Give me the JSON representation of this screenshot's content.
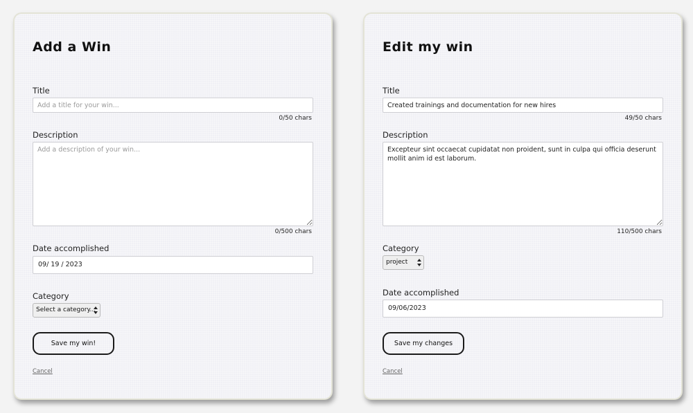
{
  "add_form": {
    "title": "Add a Win",
    "title_label": "Title",
    "title_placeholder": "Add a title for your win...",
    "title_value": "",
    "title_counter": "0/50 chars",
    "description_label": "Description",
    "description_placeholder": "Add a description of your win...",
    "description_value": "",
    "description_counter": "0/500 chars",
    "date_label": "Date accomplished",
    "date_value": "09/ 19 / 2023",
    "category_label": "Category",
    "category_selected": "Select a category...",
    "save_label": "Save my win!",
    "cancel_label": "Cancel"
  },
  "edit_form": {
    "title": "Edit my win",
    "title_label": "Title",
    "title_value": "Created trainings and documentation for new hires",
    "title_counter": "49/50 chars",
    "description_label": "Description",
    "description_value": "Excepteur sint occaecat cupidatat non proident, sunt in culpa qui officia deserunt mollit anim id est laborum.",
    "description_counter": "110/500 chars",
    "category_label": "Category",
    "category_selected": "project",
    "date_label": "Date accomplished",
    "date_value": "09/06/2023",
    "save_label": "Save my changes",
    "cancel_label": "Cancel"
  },
  "icons": {
    "select_arrows": "updown-arrows-icon"
  }
}
